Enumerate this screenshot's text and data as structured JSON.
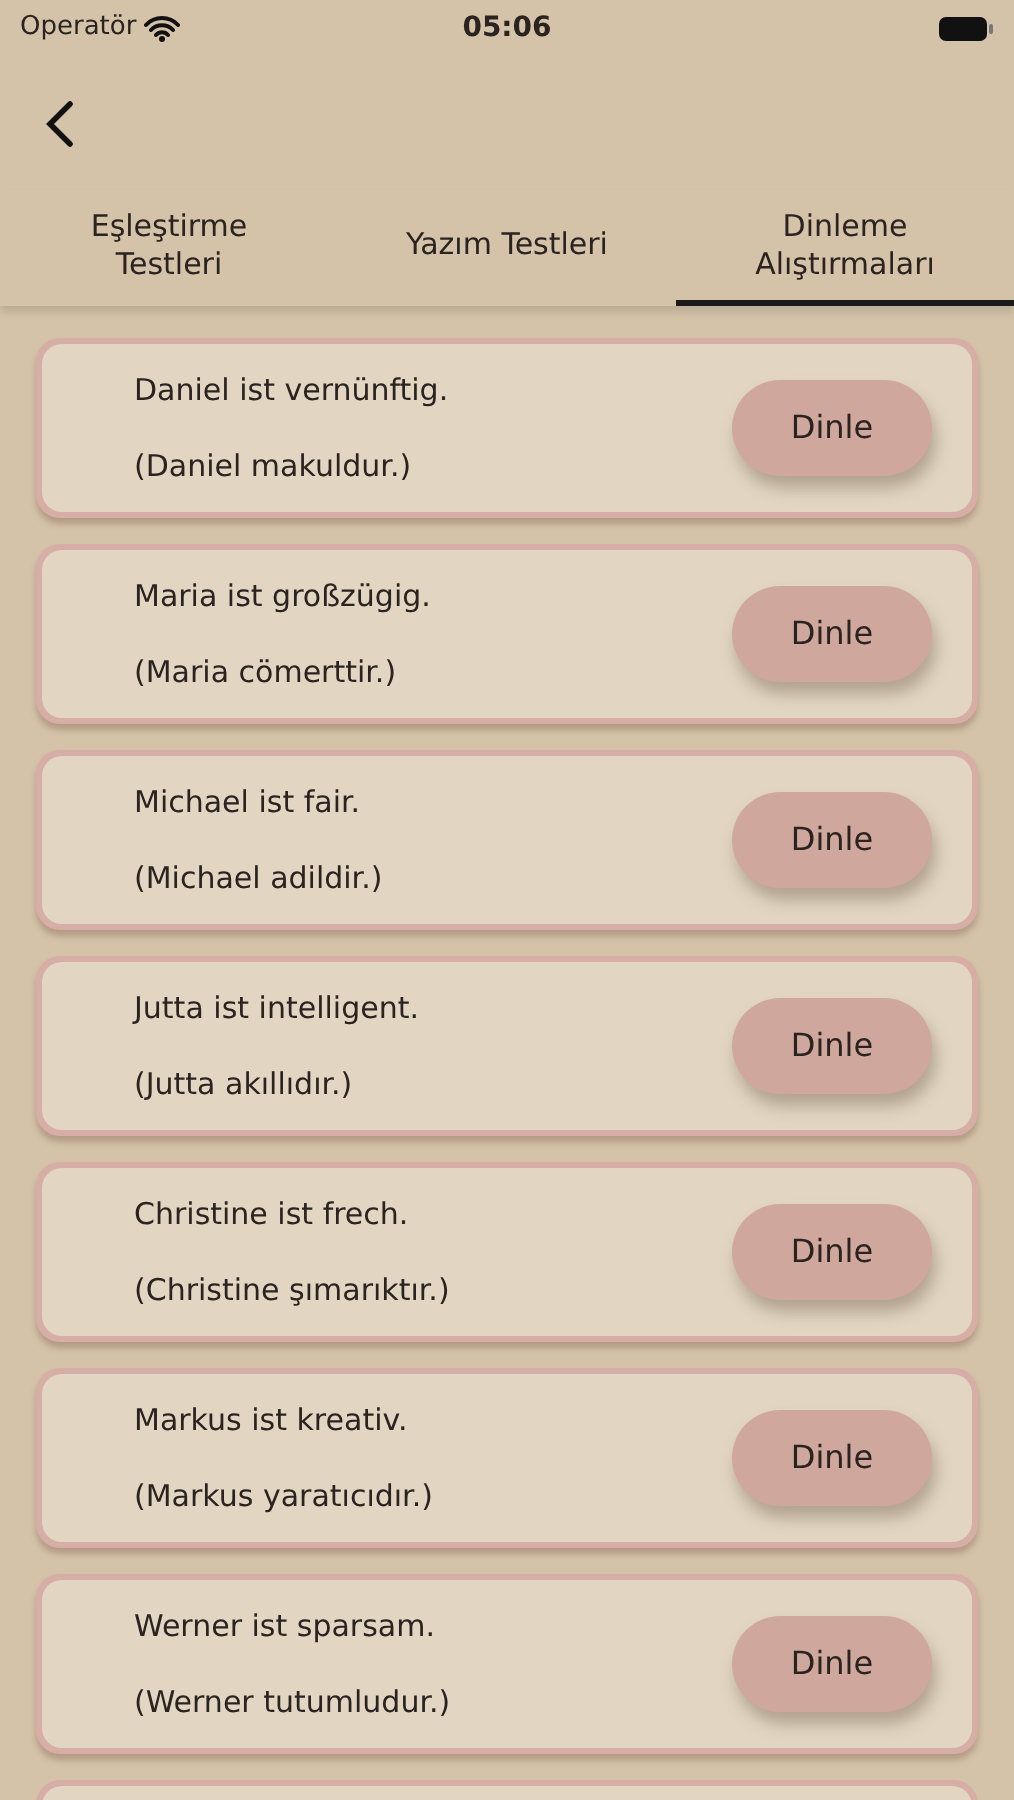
{
  "status_bar": {
    "carrier": "Operatör",
    "time": "05:06"
  },
  "tabs": [
    {
      "label": "Eşleştirme Testleri",
      "selected": false
    },
    {
      "label": "Yazım Testleri",
      "selected": false
    },
    {
      "label": "Dinleme Alıştırmaları",
      "selected": true
    }
  ],
  "items": [
    {
      "sentence": "Daniel ist vernünftig.",
      "translation": "(Daniel makuldur.)",
      "button": "Dinle"
    },
    {
      "sentence": "Maria ist großzügig.",
      "translation": "(Maria cömerttir.)",
      "button": "Dinle"
    },
    {
      "sentence": "Michael ist fair.",
      "translation": "(Michael adildir.)",
      "button": "Dinle"
    },
    {
      "sentence": "Jutta ist intelligent.",
      "translation": "(Jutta akıllıdır.)",
      "button": "Dinle"
    },
    {
      "sentence": "Christine ist frech.",
      "translation": "(Christine şımarıktır.)",
      "button": "Dinle"
    },
    {
      "sentence": "Markus ist kreativ.",
      "translation": "(Markus yaratıcıdır.)",
      "button": "Dinle"
    },
    {
      "sentence": "Werner ist sparsam.",
      "translation": "(Werner tutumludur.)",
      "button": "Dinle"
    }
  ]
}
